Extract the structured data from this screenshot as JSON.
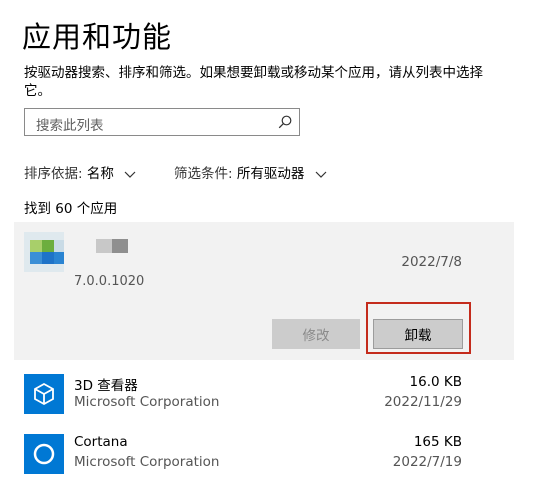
{
  "header": {
    "title": "应用和功能",
    "description": "按驱动器搜索、排序和筛选。如果想要卸载或移动某个应用，请从列表中选择它。"
  },
  "search": {
    "placeholder": "搜索此列表",
    "icon": "search-icon"
  },
  "sort": {
    "label": "排序依据:",
    "value": "名称"
  },
  "filter": {
    "label": "筛选条件:",
    "value": "所有驱动器"
  },
  "count_text": "找到 60 个应用",
  "selected_app": {
    "version": "7.0.0.1020",
    "date": "2022/7/8",
    "modify_label": "修改",
    "uninstall_label": "卸载"
  },
  "apps": [
    {
      "name": "3D 查看器",
      "publisher": "Microsoft Corporation",
      "size": "16.0 KB",
      "date": "2022/11/29",
      "icon": "cube-icon"
    },
    {
      "name": "Cortana",
      "publisher": "Microsoft Corporation",
      "size": "165 KB",
      "date": "2022/7/19",
      "icon": "cortana-ring-icon"
    }
  ],
  "colors": {
    "accent": "#0078d4",
    "highlight": "#c42b1c",
    "selected_bg": "#f2f2f2",
    "button_bg": "#cccccc"
  }
}
